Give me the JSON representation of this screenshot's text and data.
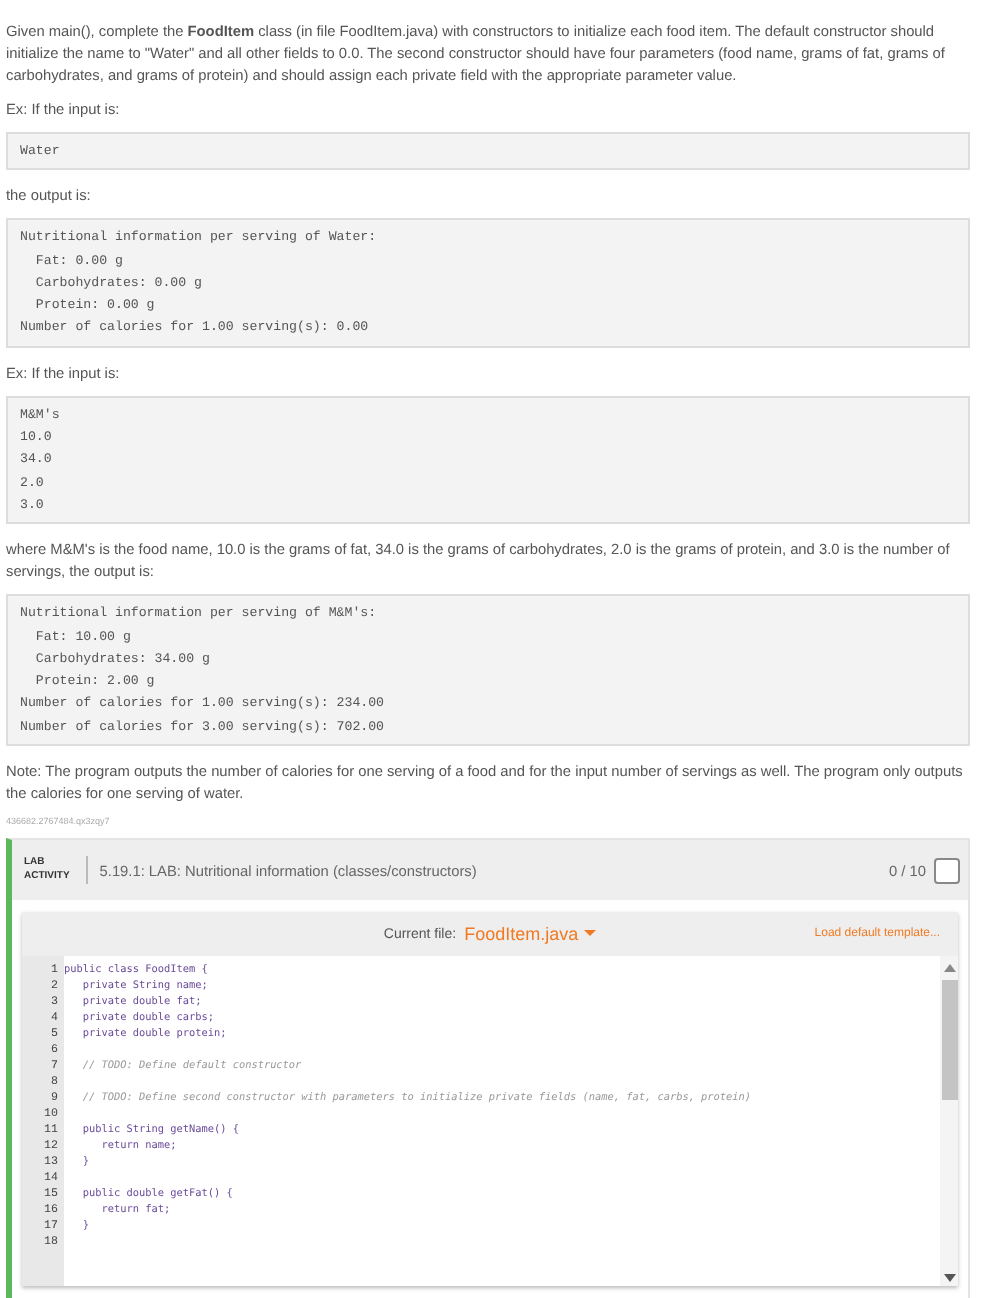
{
  "intro": "Given main(), complete the **FoodItem** class (in file FoodItem.java) with constructors to initialize each food item. The default constructor should initialize the name to \"Water\" and all other fields to 0.0. The second constructor should have four parameters (food name, grams of fat, grams of carbohydrates, and grams of protein) and should assign each private field with the appropriate parameter value.",
  "blocks": [
    {
      "kind": "text",
      "text": "Ex: If the input is:"
    },
    {
      "kind": "code",
      "lines": [
        "Water"
      ]
    },
    {
      "kind": "text",
      "text": "the output is:"
    },
    {
      "kind": "code",
      "lines": [
        "Nutritional information per serving of Water:",
        "  Fat: 0.00 g",
        "  Carbohydrates: 0.00 g",
        "  Protein: 0.00 g",
        "Number of calories for 1.00 serving(s): 0.00"
      ]
    },
    {
      "kind": "text",
      "text": "Ex: If the input is:"
    },
    {
      "kind": "code",
      "lines": [
        "M&M's",
        "10.0",
        "34.0",
        "2.0",
        "3.0"
      ]
    },
    {
      "kind": "text",
      "text": "where M&M's is the food name, 10.0 is the grams of fat, 34.0 is the grams of carbohydrates, 2.0 is the grams of protein, and 3.0 is the number of servings, the output is:"
    },
    {
      "kind": "code",
      "lines": [
        "Nutritional information per serving of M&M's:",
        "  Fat: 10.00 g",
        "  Carbohydrates: 34.00 g",
        "  Protein: 2.00 g",
        "Number of calories for 1.00 serving(s): 234.00",
        "Number of calories for 3.00 serving(s): 702.00"
      ]
    },
    {
      "kind": "text",
      "text": "Note: The program outputs the number of calories for one serving of a food and for the input number of servings as well. The program only outputs the calories for one serving of water."
    },
    {
      "kind": "id",
      "text": "436682.2767484.qx3zqy7"
    }
  ],
  "lab": {
    "badge_top": "LAB",
    "badge_bottom": "ACTIVITY",
    "title": "5.19.1: LAB: Nutritional information (classes/constructors)",
    "score": "0 / 10",
    "completed": false
  },
  "editor": {
    "file_label": "Current file:",
    "file_name": "FoodItem.java",
    "load_link": "Load default template...",
    "lines": [
      {
        "number": "1",
        "kind": "code",
        "text": "public class FoodItem {"
      },
      {
        "number": "2",
        "kind": "code",
        "text": "   private String name;"
      },
      {
        "number": "3",
        "kind": "code",
        "text": "   private double fat;"
      },
      {
        "number": "4",
        "kind": "code",
        "text": "   private double carbs;"
      },
      {
        "number": "5",
        "kind": "code",
        "text": "   private double protein;"
      },
      {
        "number": "6",
        "kind": "blank"
      },
      {
        "number": "7",
        "kind": "comment",
        "text": "   // TODO: Define default constructor"
      },
      {
        "number": "8",
        "kind": "blank"
      },
      {
        "number": "9",
        "kind": "comment",
        "text": "   // TODO: Define second constructor with parameters to initialize private fields (name, fat, carbs, protein)"
      },
      {
        "number": "10",
        "kind": "blank"
      },
      {
        "number": "11",
        "kind": "code",
        "text": "   public String getName() {"
      },
      {
        "number": "12",
        "kind": "code",
        "text": "      return name;"
      },
      {
        "number": "13",
        "kind": "code",
        "text": "   }"
      },
      {
        "number": "14",
        "kind": "blank"
      },
      {
        "number": "15",
        "kind": "code",
        "text": "   public double getFat() {"
      },
      {
        "number": "16",
        "kind": "code",
        "text": "      return fat;"
      },
      {
        "number": "17",
        "kind": "code",
        "text": "   }"
      },
      {
        "number": "18",
        "kind": "blank"
      }
    ]
  }
}
